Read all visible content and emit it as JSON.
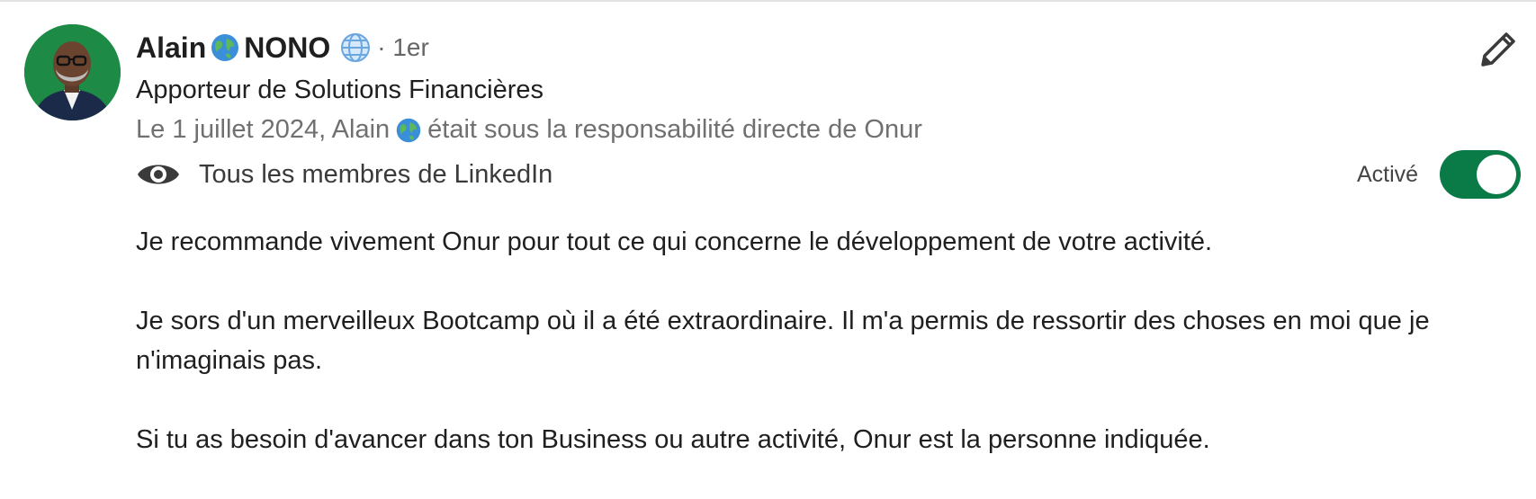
{
  "recommender": {
    "first_name": "Alain",
    "last_name": "NONO",
    "connection_degree": "· 1er",
    "headline": "Apporteur de Solutions Financières",
    "avatar_icon": "person-avatar"
  },
  "relationship": {
    "prefix": "Le 1 juillet 2024, Alain",
    "suffix": "était sous la responsabilité directe de Onur"
  },
  "visibility": {
    "icon": "eye-icon",
    "label": "Tous les membres de LinkedIn"
  },
  "toggle": {
    "label": "Activé",
    "state": true,
    "on_color": "#0a7a47"
  },
  "edit": {
    "icon": "pencil-icon"
  },
  "recommendation": {
    "paragraphs": [
      "Je recommande vivement Onur pour tout ce qui concerne le développement de votre activité.",
      "Je sors d'un merveilleux Bootcamp où il a été extraordinaire. Il m'a permis de ressortir des choses en moi que je n'imaginais pas.",
      "Si tu as besoin d'avancer dans ton Business ou autre activité, Onur est la personne indiquée."
    ]
  },
  "colors": {
    "avatar_bg": "#1d8a45",
    "secondary_text": "#707070"
  }
}
